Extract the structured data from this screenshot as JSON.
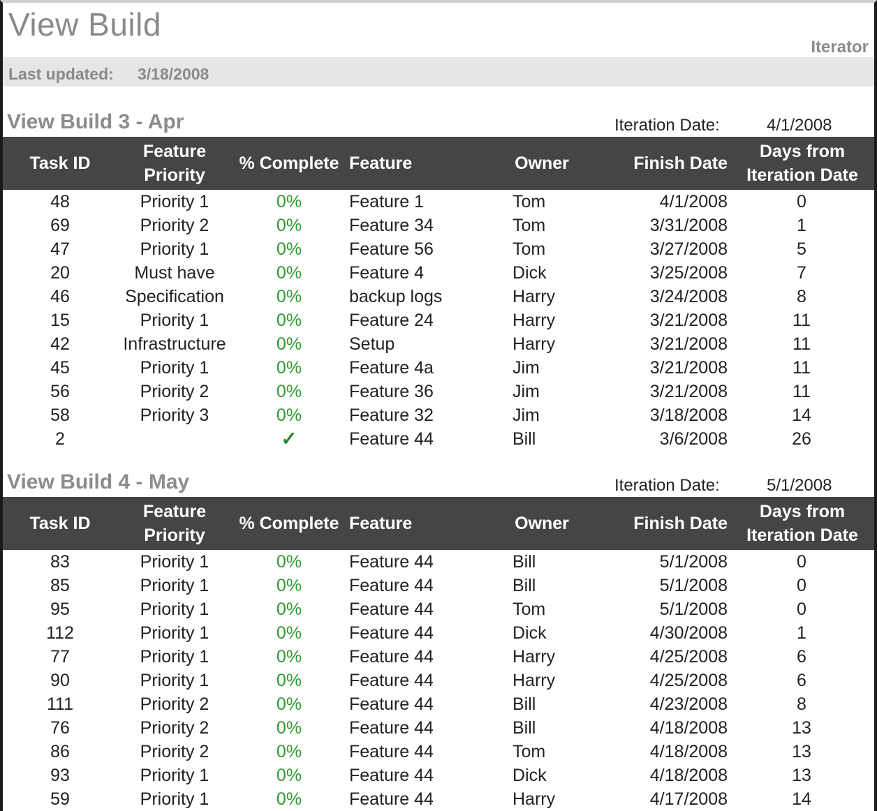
{
  "page": {
    "title": "View Build",
    "app_label": "Iterator",
    "last_updated_label": "Last updated:",
    "last_updated_value": "3/18/2008"
  },
  "columns": {
    "task_id": "Task ID",
    "feature_priority": "Feature Priority",
    "percent_complete": "% Complete",
    "feature": "Feature",
    "owner": "Owner",
    "finish_date": "Finish Date",
    "days_from_iteration": "Days from Iteration Date"
  },
  "iteration_date_label": "Iteration Date:",
  "sections": [
    {
      "title": "View Build 3 - Apr",
      "iteration_date": "4/1/2008",
      "rows": [
        {
          "task_id": "48",
          "priority": "Priority 1",
          "pct": "0%",
          "feature": "Feature 1",
          "owner": "Tom",
          "finish": "4/1/2008",
          "days": "0"
        },
        {
          "task_id": "69",
          "priority": "Priority 2",
          "pct": "0%",
          "feature": "Feature 34",
          "owner": "Tom",
          "finish": "3/31/2008",
          "days": "1"
        },
        {
          "task_id": "47",
          "priority": "Priority 1",
          "pct": "0%",
          "feature": "Feature 56",
          "owner": "Tom",
          "finish": "3/27/2008",
          "days": "5"
        },
        {
          "task_id": "20",
          "priority": "Must have",
          "pct": "0%",
          "feature": "Feature 4",
          "owner": "Dick",
          "finish": "3/25/2008",
          "days": "7"
        },
        {
          "task_id": "46",
          "priority": "Specification",
          "pct": "0%",
          "feature": "backup logs",
          "owner": "Harry",
          "finish": "3/24/2008",
          "days": "8"
        },
        {
          "task_id": "15",
          "priority": "Priority 1",
          "pct": "0%",
          "feature": "Feature 24",
          "owner": "Harry",
          "finish": "3/21/2008",
          "days": "11"
        },
        {
          "task_id": "42",
          "priority": "Infrastructure",
          "pct": "0%",
          "feature": "Setup",
          "owner": "Harry",
          "finish": "3/21/2008",
          "days": "11"
        },
        {
          "task_id": "45",
          "priority": "Priority 1",
          "pct": "0%",
          "feature": "Feature 4a",
          "owner": "Jim",
          "finish": "3/21/2008",
          "days": "11"
        },
        {
          "task_id": "56",
          "priority": "Priority 2",
          "pct": "0%",
          "feature": "Feature 36",
          "owner": "Jim",
          "finish": "3/21/2008",
          "days": "11"
        },
        {
          "task_id": "58",
          "priority": "Priority 3",
          "pct": "0%",
          "feature": "Feature 32",
          "owner": "Jim",
          "finish": "3/18/2008",
          "days": "14"
        },
        {
          "task_id": "2",
          "priority": "",
          "pct": "✓",
          "feature": "Feature 44",
          "owner": "Bill",
          "finish": "3/6/2008",
          "days": "26"
        }
      ]
    },
    {
      "title": "View Build 4 - May",
      "iteration_date": "5/1/2008",
      "rows": [
        {
          "task_id": "83",
          "priority": "Priority 1",
          "pct": "0%",
          "feature": "Feature 44",
          "owner": "Bill",
          "finish": "5/1/2008",
          "days": "0"
        },
        {
          "task_id": "85",
          "priority": "Priority 1",
          "pct": "0%",
          "feature": "Feature 44",
          "owner": "Bill",
          "finish": "5/1/2008",
          "days": "0"
        },
        {
          "task_id": "95",
          "priority": "Priority 1",
          "pct": "0%",
          "feature": "Feature 44",
          "owner": "Tom",
          "finish": "5/1/2008",
          "days": "0"
        },
        {
          "task_id": "112",
          "priority": "Priority 1",
          "pct": "0%",
          "feature": "Feature 44",
          "owner": "Dick",
          "finish": "4/30/2008",
          "days": "1"
        },
        {
          "task_id": "77",
          "priority": "Priority 1",
          "pct": "0%",
          "feature": "Feature 44",
          "owner": "Harry",
          "finish": "4/25/2008",
          "days": "6"
        },
        {
          "task_id": "90",
          "priority": "Priority 1",
          "pct": "0%",
          "feature": "Feature 44",
          "owner": "Harry",
          "finish": "4/25/2008",
          "days": "6"
        },
        {
          "task_id": "111",
          "priority": "Priority 2",
          "pct": "0%",
          "feature": "Feature 44",
          "owner": "Bill",
          "finish": "4/23/2008",
          "days": "8"
        },
        {
          "task_id": "76",
          "priority": "Priority 2",
          "pct": "0%",
          "feature": "Feature 44",
          "owner": "Bill",
          "finish": "4/18/2008",
          "days": "13"
        },
        {
          "task_id": "86",
          "priority": "Priority 2",
          "pct": "0%",
          "feature": "Feature 44",
          "owner": "Tom",
          "finish": "4/18/2008",
          "days": "13"
        },
        {
          "task_id": "93",
          "priority": "Priority 1",
          "pct": "0%",
          "feature": "Feature 44",
          "owner": "Dick",
          "finish": "4/18/2008",
          "days": "13"
        },
        {
          "task_id": "59",
          "priority": "Priority 1",
          "pct": "0%",
          "feature": "Feature 44",
          "owner": "Harry",
          "finish": "4/17/2008",
          "days": "14"
        }
      ]
    }
  ],
  "colors": {
    "header_bg": "#454545",
    "percent_green": "#2e9a2e",
    "title_gray": "#8a8a8a"
  }
}
